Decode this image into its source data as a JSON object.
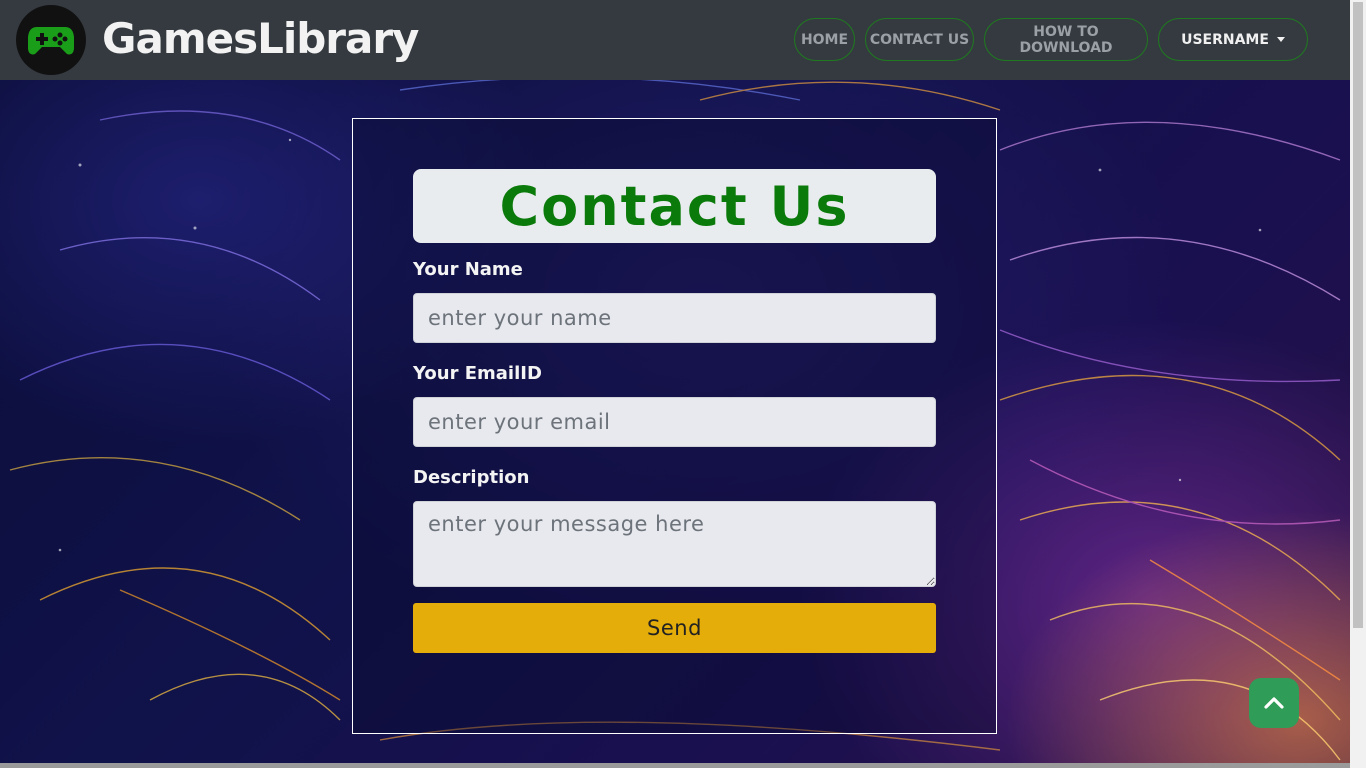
{
  "brand": {
    "name": "GamesLibrary",
    "icon": "gamepad-icon",
    "icon_color": "#1a9e1a"
  },
  "nav": {
    "home": "HOME",
    "contact": "CONTACT US",
    "how_to_download": "HOW TO DOWNLOAD",
    "username": "USERNAME"
  },
  "form": {
    "title": "Contact Us",
    "name_label": "Your Name",
    "name_placeholder": "enter your name",
    "email_label": "Your EmailID",
    "email_placeholder": "enter your email",
    "description_label": "Description",
    "description_placeholder": "enter your message here",
    "send_label": "Send"
  },
  "colors": {
    "navbar": "#343a40",
    "accent_green": "#0a7a0a",
    "send_button": "#e5ad09",
    "back_to_top": "#2f9c57"
  },
  "back_to_top": {
    "icon": "chevron-up-icon"
  }
}
